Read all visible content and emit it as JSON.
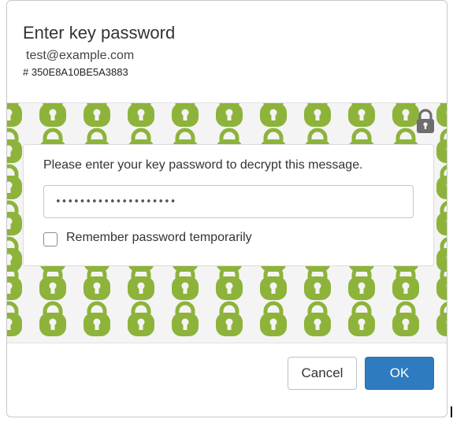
{
  "dialog": {
    "title": "Enter key password",
    "email": "test@example.com",
    "key_id": "# 350E8A10BE5A3883"
  },
  "panel": {
    "instruction": "Please enter your key password to decrypt this message.",
    "password_value": "••••••••••••••••••••",
    "remember_label": "Remember password temporarily",
    "remember_checked": false
  },
  "buttons": {
    "cancel_label": "Cancel",
    "ok_label": "OK"
  },
  "icons": {
    "background_pattern": "padlock-icon",
    "corner": "lock-icon"
  },
  "colors": {
    "lock_green": "#8db33a",
    "ok_blue": "#2f7bbf",
    "pattern_bg": "#f4f4f4"
  }
}
